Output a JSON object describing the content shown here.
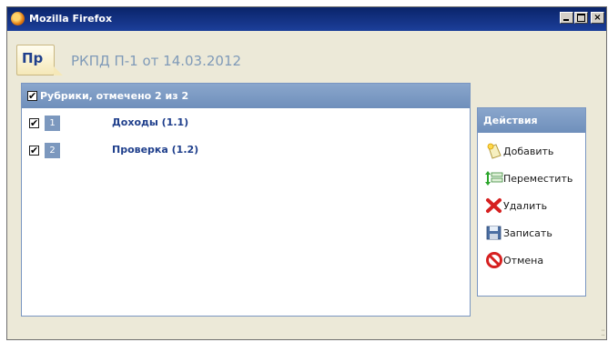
{
  "window": {
    "title": "Mozilla Firefox",
    "controls": {
      "minimize": "_",
      "maximize": "□",
      "close": "×"
    }
  },
  "document": {
    "icon_text": "Пр",
    "title": "РКПД П-1 от 14.03.2012"
  },
  "rubrics": {
    "header": "Рубрики, отмечено 2 из 2",
    "header_checked": true,
    "items": [
      {
        "number": "1",
        "label": "Доходы (1.1)",
        "checked": true
      },
      {
        "number": "2",
        "label": "Проверка (1.2)",
        "checked": true
      }
    ]
  },
  "actions": {
    "header": "Действия",
    "items": [
      {
        "label": "Добавить",
        "icon": "add-icon"
      },
      {
        "label": "Переместить",
        "icon": "move-icon"
      },
      {
        "label": "Удалить",
        "icon": "delete-icon"
      },
      {
        "label": "Записать",
        "icon": "save-icon"
      },
      {
        "label": "Отмена",
        "icon": "cancel-icon"
      }
    ]
  },
  "colors": {
    "accent": "#1f3f8c",
    "panel_header": "#7c98be",
    "title_text": "#7f9ab8"
  }
}
